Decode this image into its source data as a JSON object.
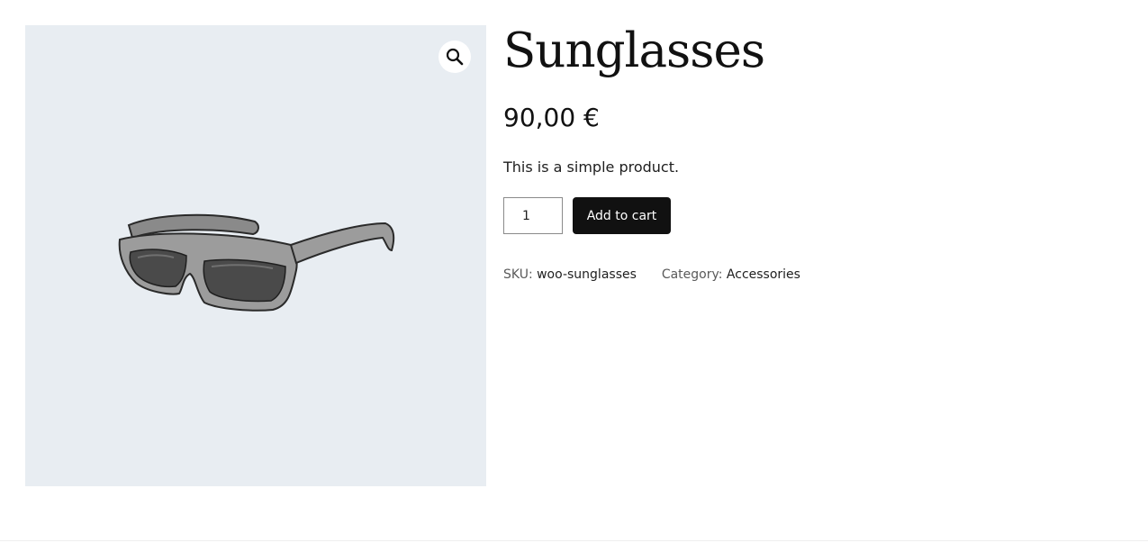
{
  "product": {
    "title": "Sunglasses",
    "price": "90,00 €",
    "short_description": "This is a simple product.",
    "image_alt": "Sunglasses",
    "gallery_background": "#e8edf2"
  },
  "cart": {
    "quantity": "1",
    "add_to_cart_label": "Add to cart"
  },
  "meta": {
    "sku_label": "SKU:",
    "sku_value": "woo-sunglasses",
    "category_label": "Category:",
    "category_value": "Accessories"
  },
  "icons": {
    "zoom": "magnifier-icon"
  },
  "colors": {
    "button_bg": "#111111",
    "button_text": "#ffffff",
    "text": "#1e1e1e"
  }
}
